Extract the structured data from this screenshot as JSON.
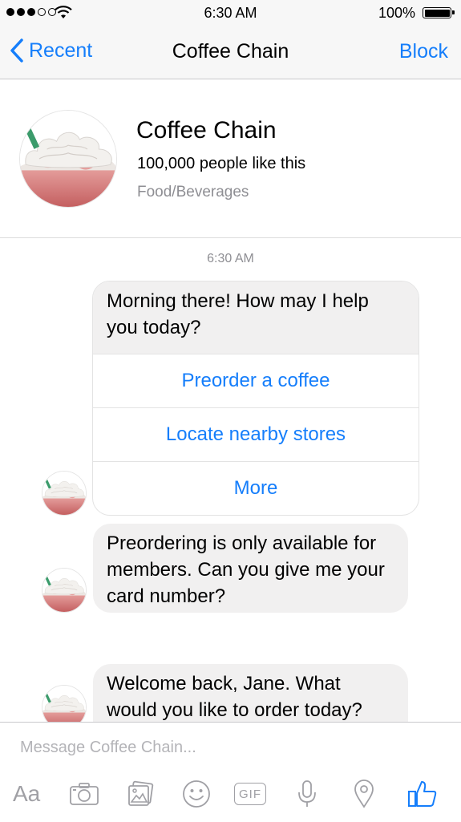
{
  "status_bar": {
    "time": "6:30 AM",
    "battery_percent": "100%",
    "signal_bars_filled": 3,
    "signal_bars_total": 5
  },
  "nav": {
    "back_label": "Recent",
    "title": "Coffee Chain",
    "action_label": "Block"
  },
  "profile": {
    "name": "Coffee Chain",
    "likes": "100,000 people like this",
    "category": "Food/Beverages"
  },
  "chat": {
    "timestamp": "6:30 AM",
    "messages": [
      {
        "text": "Morning there! How may I help you today?",
        "options": [
          "Preorder a coffee",
          "Locate nearby stores",
          "More"
        ]
      },
      {
        "text": "Preordering is only available for members. Can you give me your card number?"
      },
      {
        "text": "Welcome back, Jane. What would you like to order today?"
      }
    ]
  },
  "composer": {
    "placeholder": "Message Coffee Chain...",
    "tools": [
      "text-format-icon",
      "camera-icon",
      "gallery-icon",
      "emoji-icon",
      "gif-icon",
      "microphone-icon",
      "location-icon",
      "like-icon"
    ],
    "text_tool_label": "Aa",
    "gif_label": "GIF"
  },
  "colors": {
    "accent": "#157efb",
    "bubble": "#f1f0f0",
    "muted": "#8e8e93"
  }
}
